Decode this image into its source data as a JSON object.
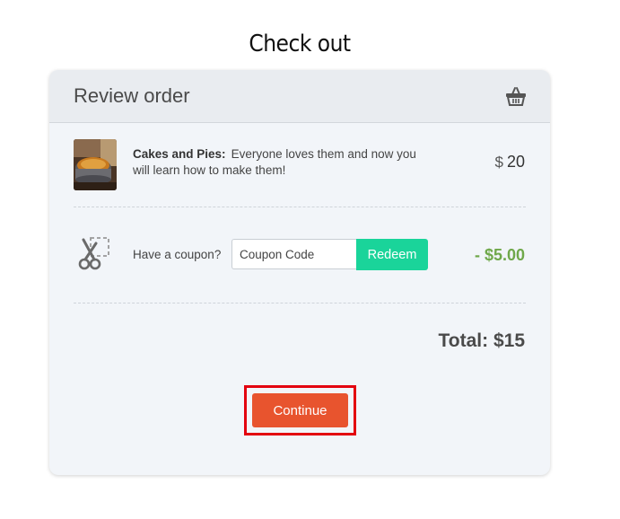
{
  "page": {
    "title": "Check out"
  },
  "card": {
    "header_title": "Review order",
    "header_icon": "basket-icon"
  },
  "item": {
    "image_icon": "cake-thumbnail",
    "name": "Cakes and Pies:",
    "description": "Everyone loves them and now you will learn how to make them!",
    "currency": "$",
    "price": "20"
  },
  "coupon": {
    "icon": "scissors-coupon-icon",
    "label": "Have a coupon?",
    "placeholder": "Coupon Code",
    "value": "",
    "redeem_label": "Redeem",
    "discount": "- $5.00"
  },
  "summary": {
    "total": "Total: $15"
  },
  "actions": {
    "continue_label": "Continue"
  },
  "colors": {
    "accent_green": "#1ad49a",
    "discount_green": "#6fa84a",
    "continue_orange": "#e8542e",
    "highlight_red": "#e3000f",
    "card_bg": "#f2f5f9"
  }
}
